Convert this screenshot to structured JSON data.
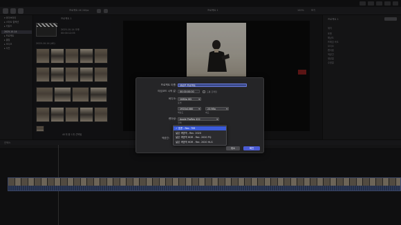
{
  "toolbar": {
    "library_label": "라이브러리",
    "project_label": "프로젝트 4K 24fps",
    "viewer_label": "프로젝트 1",
    "zoom_label": "100%",
    "view_label": "보기"
  },
  "sidebar": {
    "items": [
      {
        "label": "▾ 라이브러리"
      },
      {
        "label": "▸ 스마트 컬렉션"
      },
      {
        "label": "▸ 키워드"
      },
      {
        "label": "2025-10-14"
      },
      {
        "label": "▸ 프로젝트"
      },
      {
        "label": "▸ 클립"
      },
      {
        "label": "▸ 오디오"
      },
      {
        "label": "▸ 사진"
      }
    ]
  },
  "browser": {
    "project_title": "프로젝트 1",
    "project_meta1": "2025-10-14 오후",
    "project_meta2": "00:00:12:05",
    "section_header": "2025-10-14 (40)",
    "footer": "40개 중 1개 선택됨"
  },
  "inspector": {
    "title": "프로젝트 1",
    "rows": [
      "위치",
      "포맷",
      "해상도",
      "프레임 속도",
      "오디오",
      "렌더링",
      "색공간",
      "생성일",
      "수정일"
    ]
  },
  "timeline": {
    "header_label": "인덱스",
    "timecode": "00:00:00:00"
  },
  "dialog": {
    "project_name_label": "프로젝트 이름:",
    "project_name_value": "새로운 프로젝트",
    "start_tc_label": "타임코드 시작 값:",
    "start_tc_value": "00:00:00:00",
    "dropframe_label": "드롭 프레임",
    "video_label": "비디오:",
    "video_format": "1080p HD",
    "format_sub": "포맷",
    "resolution": "1920x1080",
    "resolution_sub": "해상도",
    "rate": "23.98p",
    "rate_sub": "속도",
    "render_label": "렌더링:",
    "codec": "Apple ProRes 422",
    "codec_sub": "코덱",
    "colorspace_label": "색공간:",
    "cancel_label": "취소",
    "ok_label": "확인"
  },
  "color_menu": {
    "items": [
      {
        "label": "✓ 표준 - Rec. 709"
      },
      {
        "label": "넓은 색영역 - Rec. 2020"
      },
      {
        "label": "넓은 색영역 HDR - Rec. 2020 PQ"
      },
      {
        "label": "넓은 색영역 HDR - Rec. 2020 HLG"
      }
    ]
  }
}
